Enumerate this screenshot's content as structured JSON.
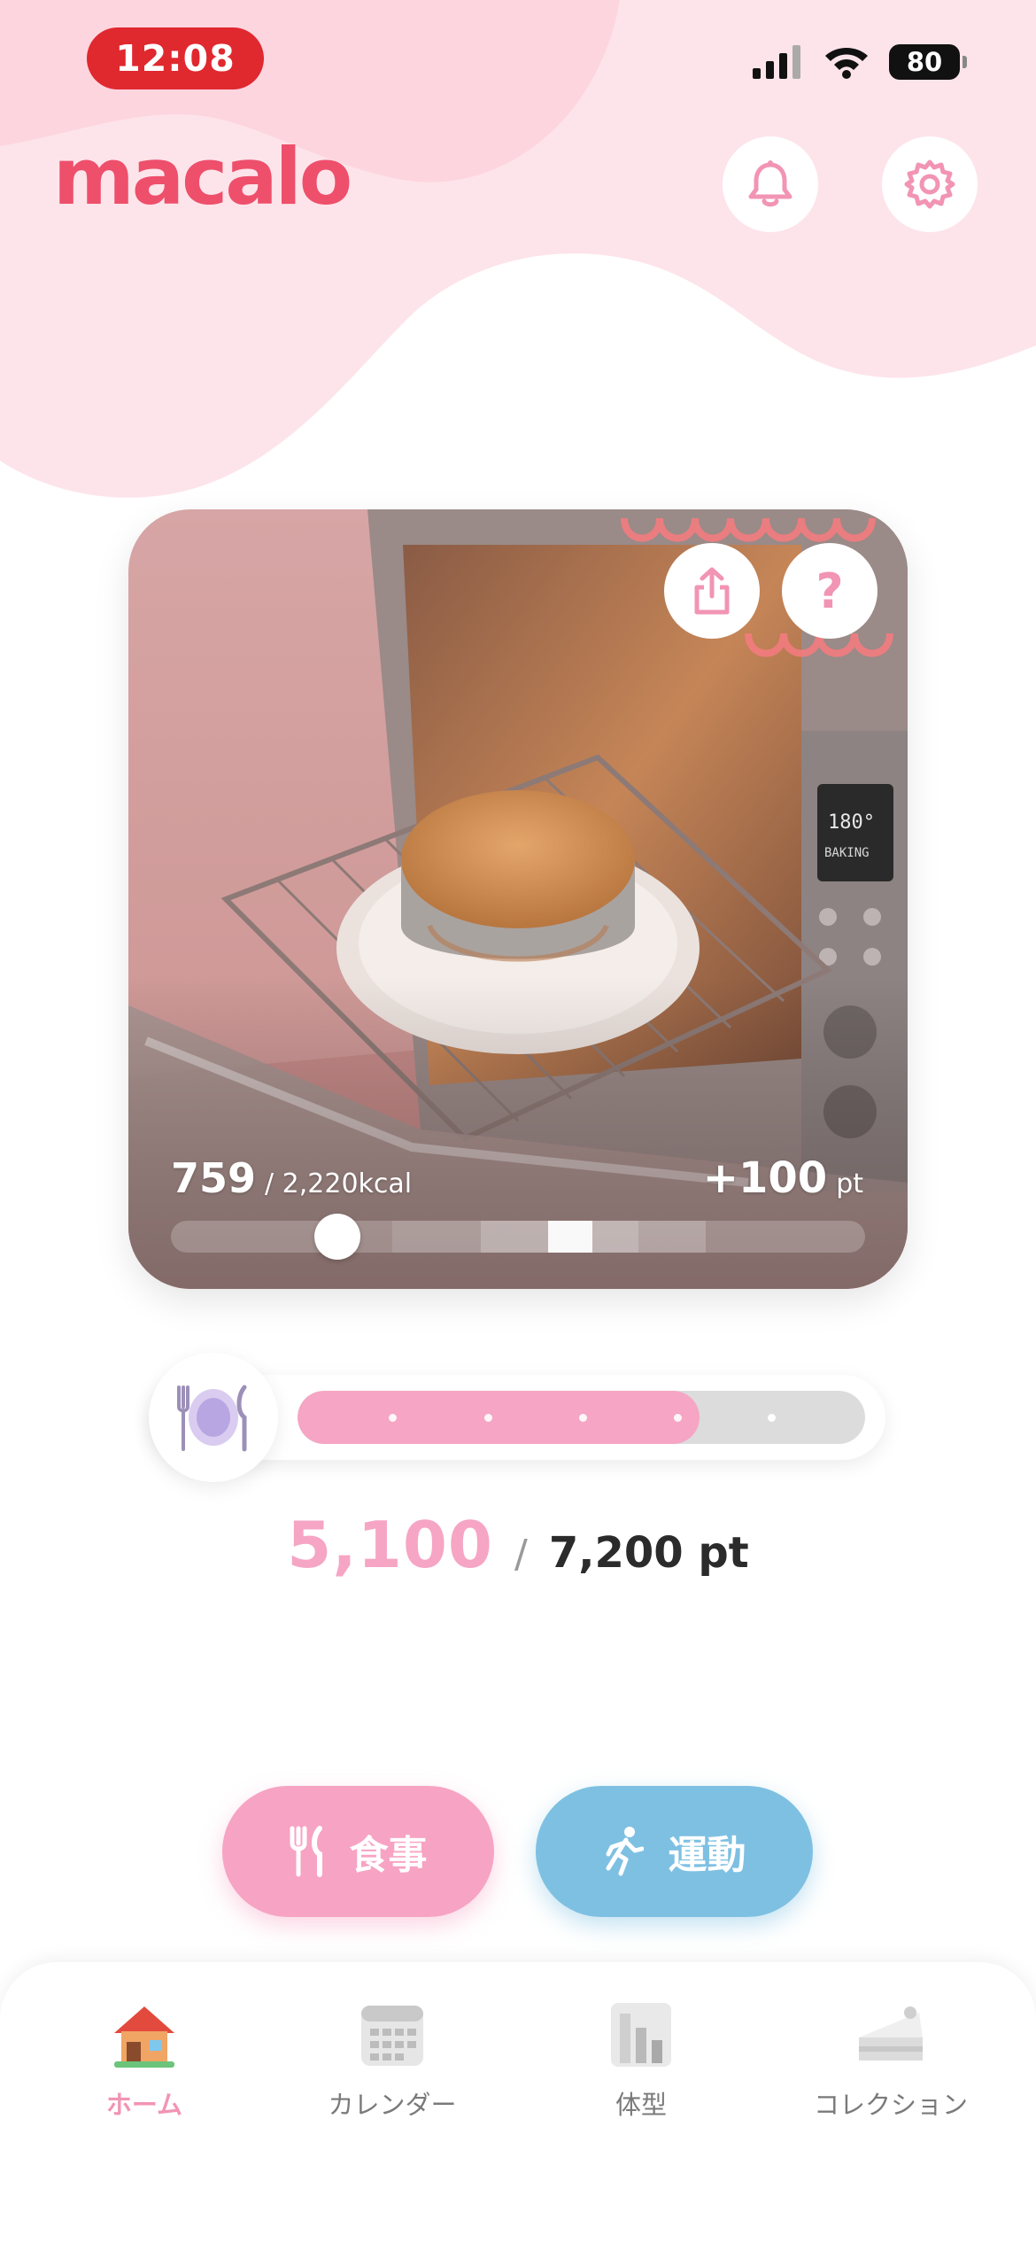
{
  "status_bar": {
    "time": "12:08",
    "battery": "80",
    "icons": [
      "cellular-signal-icon",
      "wifi-icon",
      "battery-icon"
    ]
  },
  "header": {
    "logo": "macalo",
    "notification_icon": "bell-icon",
    "settings_icon": "gear-icon"
  },
  "hero": {
    "image": "oven-with-cake-photo",
    "share_icon": "share-icon",
    "help_label": "?",
    "kcal_current": "759",
    "kcal_goal": "/ 2,220kcal",
    "kcal_progress": 0.24,
    "points_delta": "+100",
    "points_unit": "pt"
  },
  "progress": {
    "icon": "plate-cutlery-icon",
    "current": "5,100",
    "separator": "/",
    "goal": "7,200 pt",
    "fraction": 0.708
  },
  "actions": {
    "meal_label": "食事",
    "meal_icon": "fork-knife-icon",
    "exercise_label": "運動",
    "exercise_icon": "running-person-icon"
  },
  "nav": {
    "items": [
      {
        "label": "ホーム",
        "icon": "house-icon",
        "active": true
      },
      {
        "label": "カレンダー",
        "icon": "calendar-icon",
        "active": false
      },
      {
        "label": "体型",
        "icon": "body-chart-icon",
        "active": false
      },
      {
        "label": "コレクション",
        "icon": "cake-icon",
        "active": false
      }
    ]
  },
  "colors": {
    "brand": "#ee4f6b",
    "pink": "#f6a5c4",
    "blue": "#7ec0e2",
    "status_pill": "#e0282f"
  }
}
